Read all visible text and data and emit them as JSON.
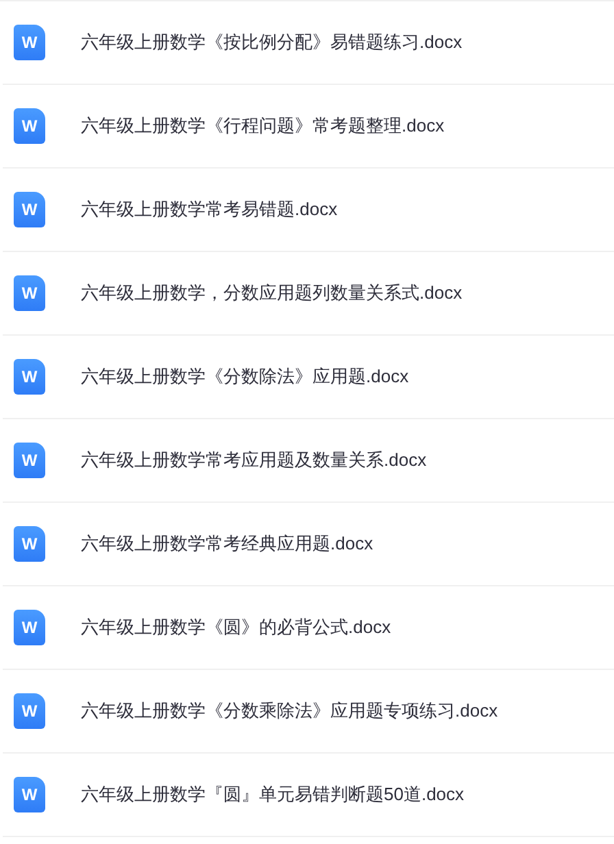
{
  "files": [
    {
      "icon_label": "W",
      "name": "六年级上册数学《按比例分配》易错题练习.docx"
    },
    {
      "icon_label": "W",
      "name": "六年级上册数学《行程问题》常考题整理.docx"
    },
    {
      "icon_label": "W",
      "name": "六年级上册数学常考易错题.docx"
    },
    {
      "icon_label": "W",
      "name": "六年级上册数学，分数应用题列数量关系式.docx"
    },
    {
      "icon_label": "W",
      "name": "六年级上册数学《分数除法》应用题.docx"
    },
    {
      "icon_label": "W",
      "name": "六年级上册数学常考应用题及数量关系.docx"
    },
    {
      "icon_label": "W",
      "name": "六年级上册数学常考经典应用题.docx"
    },
    {
      "icon_label": "W",
      "name": "六年级上册数学《圆》的必背公式.docx"
    },
    {
      "icon_label": "W",
      "name": "六年级上册数学《分数乘除法》应用题专项练习.docx"
    },
    {
      "icon_label": "W",
      "name": "六年级上册数学『圆』单元易错判断题50道.docx"
    }
  ]
}
